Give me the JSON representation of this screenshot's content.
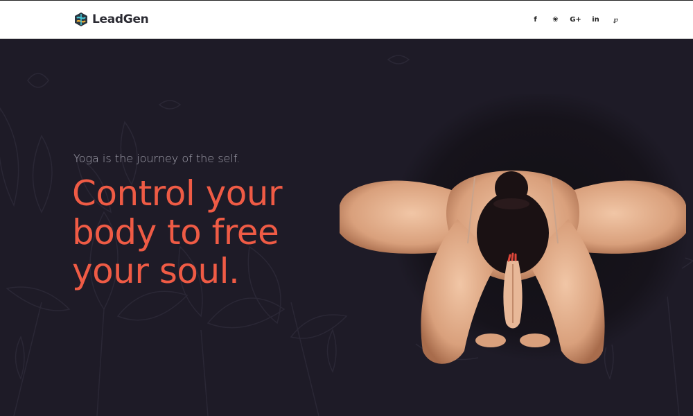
{
  "header": {
    "brand": "LeadGen",
    "social": [
      {
        "icon": "facebook-icon",
        "glyph": "f"
      },
      {
        "icon": "twitter-icon",
        "glyph": "❀"
      },
      {
        "icon": "google-plus-icon",
        "glyph": "G+"
      },
      {
        "icon": "linkedin-icon",
        "glyph": "in"
      },
      {
        "icon": "pinterest-icon",
        "glyph": "℘"
      }
    ]
  },
  "hero": {
    "tagline": "Yoga is the journey of the self.",
    "headline_lines": [
      "Control your",
      "body to free",
      "your soul."
    ]
  },
  "colors": {
    "background": "#1e1b27",
    "accent": "#ef5b45",
    "tagline": "#a7a6b2",
    "header": "#ffffff"
  }
}
